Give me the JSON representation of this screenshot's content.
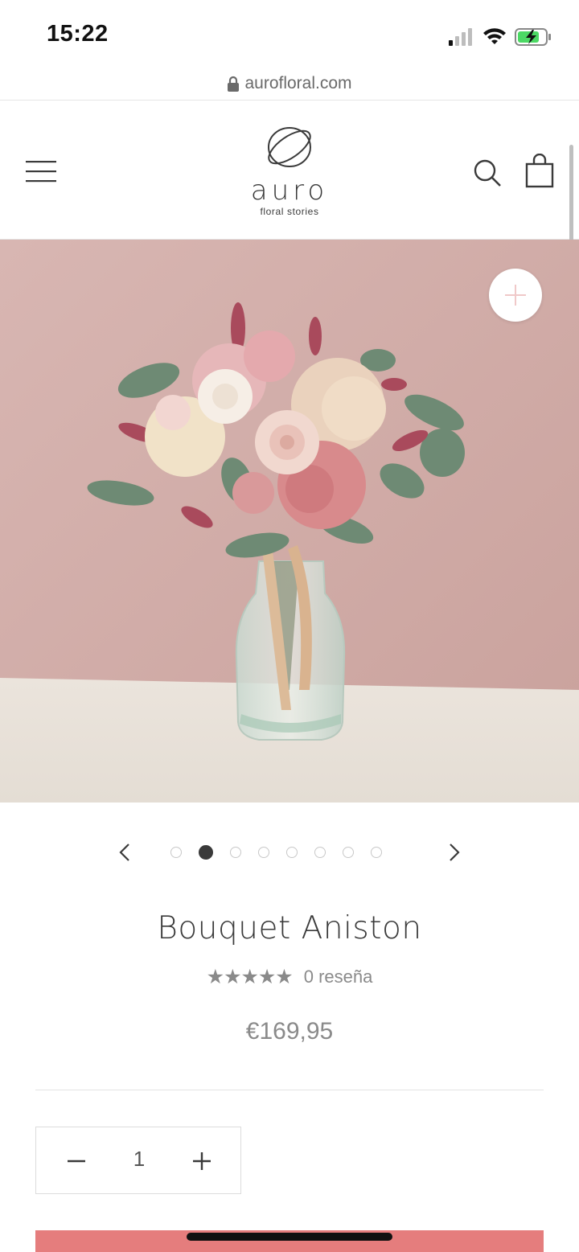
{
  "status_bar": {
    "time": "15:22"
  },
  "browser": {
    "url": "aurofloral.com"
  },
  "header": {
    "brand_name": "auro",
    "brand_tagline": "floral stories"
  },
  "product": {
    "title": "Bouquet Aniston",
    "stars": "★★★★★",
    "review_count": "0 reseña",
    "price": "€169,95",
    "quantity": "1",
    "gallery_total": 8,
    "gallery_active_index": 1
  },
  "colors": {
    "accent": "#e57d7d",
    "image_background": "#d4b0ac",
    "text": "#3a3a3a",
    "muted": "#8a8a8a"
  },
  "icons": [
    "lock-icon",
    "menu-icon",
    "logo-icon",
    "search-icon",
    "cart-icon",
    "zoom-plus-icon",
    "chevron-left-icon",
    "chevron-right-icon",
    "minus-icon",
    "plus-icon"
  ]
}
